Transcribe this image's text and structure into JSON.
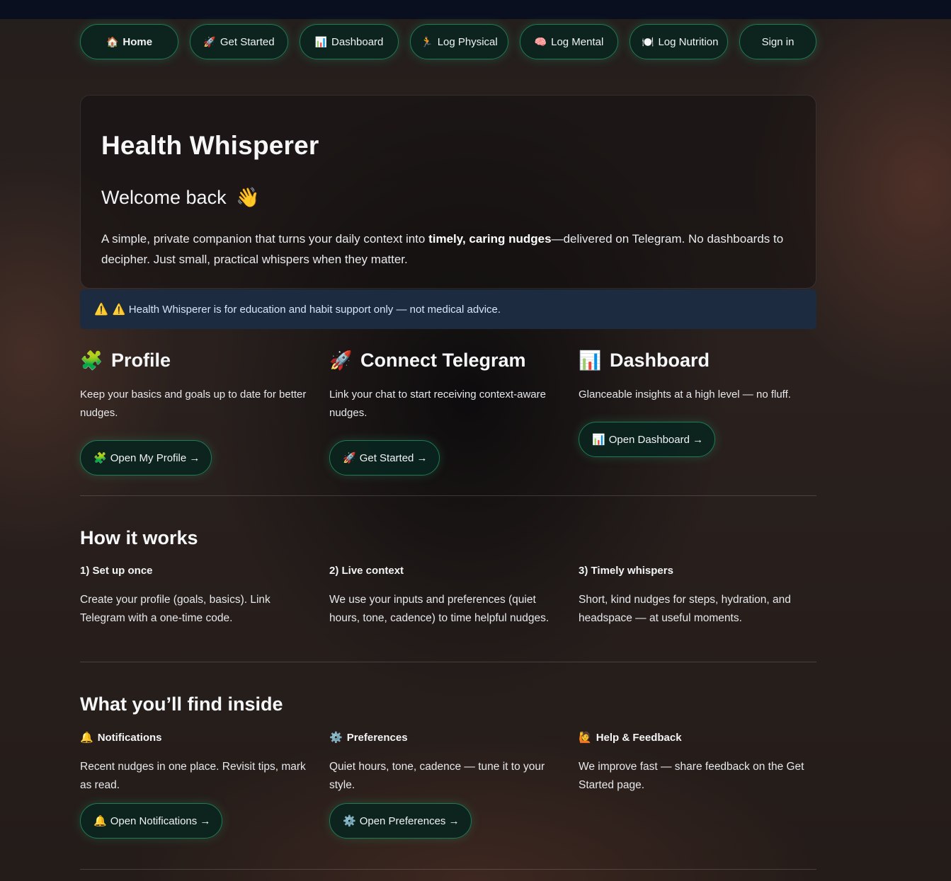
{
  "nav": {
    "items": [
      {
        "icon": "🏠",
        "icon_name": "house-icon",
        "label": "Home",
        "active": true
      },
      {
        "icon": "🚀",
        "icon_name": "rocket-icon",
        "label": "Get Started"
      },
      {
        "icon": "📊",
        "icon_name": "bar-chart-icon",
        "label": "Dashboard"
      },
      {
        "icon": "🏃",
        "icon_name": "runner-icon",
        "label": "Log Physical"
      },
      {
        "icon": "🧠",
        "icon_name": "brain-icon",
        "label": "Log Mental"
      },
      {
        "icon": "🍽️",
        "icon_name": "plate-icon",
        "label": "Log Nutrition"
      },
      {
        "label": "Sign in"
      }
    ]
  },
  "hero": {
    "title": "Health Whisperer",
    "welcome": "Welcome back",
    "welcome_icon": "👋",
    "intro_before": "A simple, private companion that turns your daily context into ",
    "intro_bold": "timely, caring nudges",
    "intro_after": "—delivered on Telegram. No dashboards to decipher. Just small, practical whispers when they matter."
  },
  "disclaimer": {
    "icon": "⚠️",
    "icon_name": "warning-icon",
    "text": "⚠️ Health Whisperer is for education and habit support only — not medical advice."
  },
  "cards": [
    {
      "icon": "🧩",
      "title": "Profile",
      "desc": "Keep your basics and goals up to date for better nudges.",
      "button_icon": "🧩",
      "button": "Open My Profile →"
    },
    {
      "icon": "🚀",
      "title": "Connect Telegram",
      "desc": "Link your chat to start receiving context-aware nudges.",
      "button_icon": "🚀",
      "button": "Get Started →"
    },
    {
      "icon": "📊",
      "title": "Dashboard",
      "desc": "Glanceable insights at a high level — no fluff.",
      "button_icon": "📊",
      "button": "Open Dashboard →"
    }
  ],
  "how_it_works": {
    "heading": "How it works",
    "steps": [
      {
        "title": "1) Set up once",
        "desc": "Create your profile (goals, basics). Link Telegram with a one-time code."
      },
      {
        "title": "2) Live context",
        "desc": "We use your inputs and preferences (quiet hours, tone, cadence) to time helpful nudges."
      },
      {
        "title": "3) Timely whispers",
        "desc": "Short, kind nudges for steps, hydration, and headspace — at useful moments."
      }
    ]
  },
  "inside": {
    "heading": "What you’ll find inside",
    "items": [
      {
        "icon": "🔔",
        "title": "Notifications",
        "desc": "Recent nudges in one place. Revisit tips, mark as read.",
        "button_icon": "🔔",
        "button": "Open Notifications →"
      },
      {
        "icon": "⚙️",
        "title": "Preferences",
        "desc": "Quiet hours, tone, cadence — tune it to your style.",
        "button_icon": "⚙️",
        "button": "Open Preferences →"
      },
      {
        "icon": "🙋",
        "title": "Help & Feedback",
        "desc": "We improve fast — share feedback on the Get Started page."
      }
    ]
  },
  "colors": {
    "accent_border": "#1f7a55",
    "button_bg": "#0a241e",
    "warning_bg": "#1c2b40",
    "topbar": "#0a0f1f"
  }
}
